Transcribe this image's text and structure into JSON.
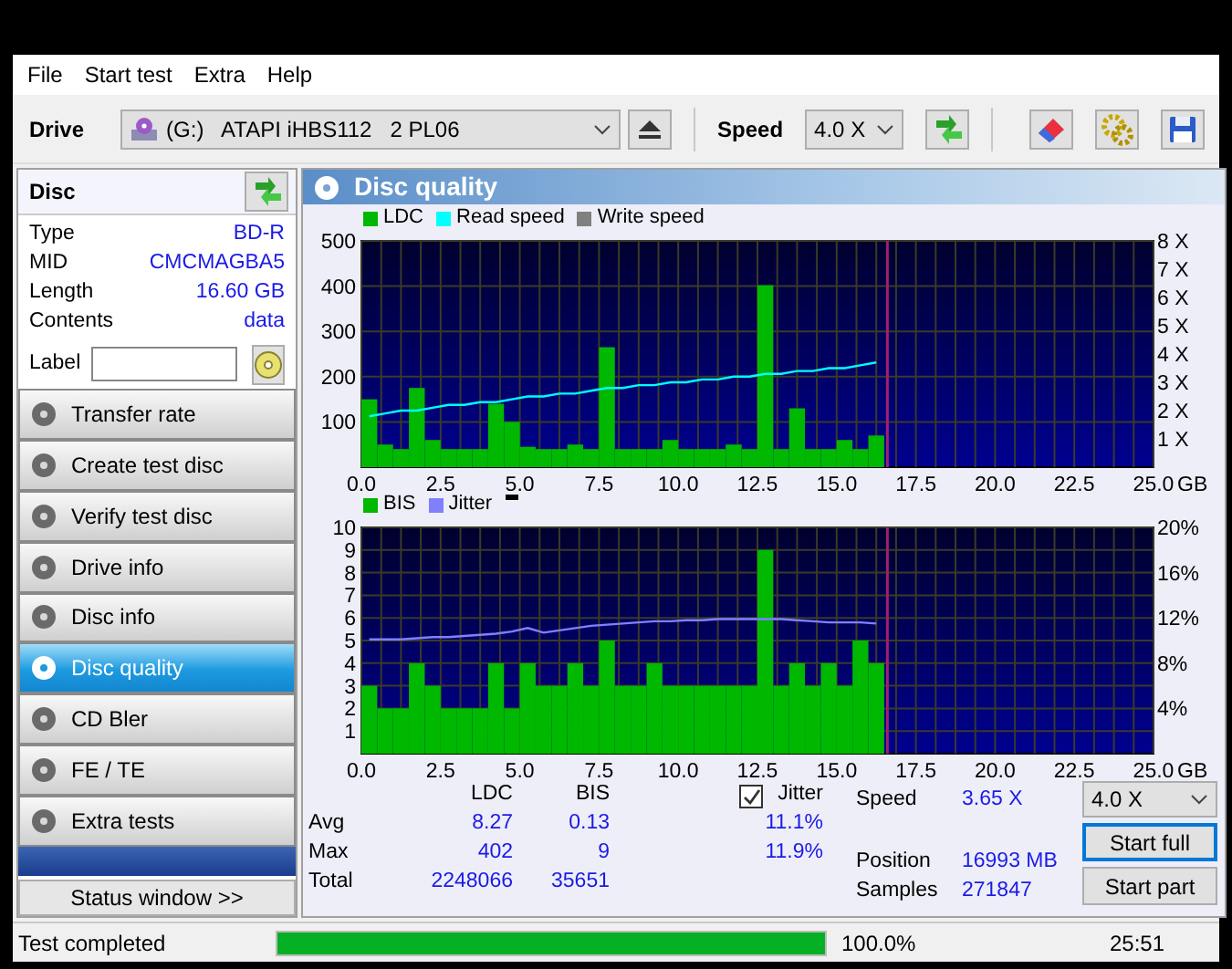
{
  "menu": [
    "File",
    "Start test",
    "Extra",
    "Help"
  ],
  "toolbar": {
    "drive_label": "Drive",
    "drive": "(G:)   ATAPI iHBS112   2 PL06",
    "speed_label": "Speed",
    "speed": "4.0 X"
  },
  "disc": {
    "title": "Disc",
    "fields": [
      {
        "label": "Type",
        "value": "BD-R"
      },
      {
        "label": "MID",
        "value": "CMCMAGBA5"
      },
      {
        "label": "Length",
        "value": "16.60 GB"
      },
      {
        "label": "Contents",
        "value": "data"
      }
    ],
    "label_caption": "Label"
  },
  "nav": [
    {
      "label": "Transfer rate",
      "selected": false
    },
    {
      "label": "Create test disc",
      "selected": false
    },
    {
      "label": "Verify test disc",
      "selected": false
    },
    {
      "label": "Drive info",
      "selected": false
    },
    {
      "label": "Disc info",
      "selected": false
    },
    {
      "label": "Disc quality",
      "selected": true
    },
    {
      "label": "CD Bler",
      "selected": false
    },
    {
      "label": "FE / TE",
      "selected": false
    },
    {
      "label": "Extra tests",
      "selected": false
    }
  ],
  "status_window_button": "Status window >>",
  "panel_title": "Disc quality",
  "charts": [
    {
      "legend_extra": [
        {
          "label": "Write speed",
          "color": "#808080"
        }
      ],
      "chart_data": {
        "type": "bar",
        "xlabel": "GB",
        "xlim": [
          0,
          25
        ],
        "ylim": [
          0,
          500
        ],
        "y2lim": [
          0,
          8
        ],
        "grid": true,
        "xticks": [
          {
            "value": 0,
            "label": "0.0"
          },
          {
            "value": 2.5,
            "label": "2.5"
          },
          {
            "value": 5,
            "label": "5.0"
          },
          {
            "value": 7.5,
            "label": "7.5"
          },
          {
            "value": 10,
            "label": "10.0"
          },
          {
            "value": 12.5,
            "label": "12.5"
          },
          {
            "value": 15,
            "label": "15.0"
          },
          {
            "value": 17.5,
            "label": "17.5"
          },
          {
            "value": 20,
            "label": "20.0"
          },
          {
            "value": 22.5,
            "label": "22.5"
          },
          {
            "value": 25,
            "label": "25.0"
          }
        ],
        "yticks": [
          100,
          200,
          300,
          400,
          500
        ],
        "y2ticks": [
          {
            "value": 1,
            "label": "1 X"
          },
          {
            "value": 2,
            "label": "2 X"
          },
          {
            "value": 3,
            "label": "3 X"
          },
          {
            "value": 4,
            "label": "4 X"
          },
          {
            "value": 5,
            "label": "5 X"
          },
          {
            "value": 6,
            "label": "6 X"
          },
          {
            "value": 7,
            "label": "7 X"
          },
          {
            "value": 8,
            "label": "8 X"
          }
        ],
        "x": [
          0.25,
          0.75,
          1.25,
          1.75,
          2.25,
          2.75,
          3.25,
          3.75,
          4.25,
          4.75,
          5.25,
          5.75,
          6.25,
          6.75,
          7.25,
          7.75,
          8.25,
          8.75,
          9.25,
          9.75,
          10.25,
          10.75,
          11.25,
          11.75,
          12.25,
          12.75,
          13.25,
          13.75,
          14.25,
          14.75,
          15.25,
          15.75,
          16.25
        ],
        "series": [
          {
            "name": "LDC",
            "color": "#00b800",
            "values": [
              150,
              50,
              40,
              175,
              60,
              40,
              40,
              40,
              140,
              100,
              45,
              40,
              40,
              50,
              40,
              265,
              40,
              40,
              40,
              60,
              40,
              40,
              40,
              50,
              40,
              402,
              40,
              130,
              40,
              40,
              60,
              40,
              70
            ]
          },
          {
            "name": "Read speed",
            "color": "#00ffff",
            "type": "line",
            "axis": "y2",
            "values": [
              1.8,
              1.9,
              2.0,
              2.0,
              2.1,
              2.2,
              2.2,
              2.3,
              2.3,
              2.4,
              2.5,
              2.5,
              2.6,
              2.6,
              2.7,
              2.8,
              2.8,
              2.9,
              2.9,
              3.0,
              3.0,
              3.1,
              3.1,
              3.2,
              3.2,
              3.3,
              3.3,
              3.4,
              3.4,
              3.5,
              3.5,
              3.6,
              3.7
            ]
          }
        ],
        "ref_lines": [
          {
            "axis": "x",
            "value": 16.6
          }
        ]
      }
    },
    {
      "chart_data": {
        "type": "bar",
        "xlabel": "GB",
        "xlim": [
          0,
          25
        ],
        "ylim": [
          0,
          10
        ],
        "y2lim": [
          0,
          20
        ],
        "grid": true,
        "xticks": [
          {
            "value": 0,
            "label": "0.0"
          },
          {
            "value": 2.5,
            "label": "2.5"
          },
          {
            "value": 5,
            "label": "5.0"
          },
          {
            "value": 7.5,
            "label": "7.5"
          },
          {
            "value": 10,
            "label": "10.0"
          },
          {
            "value": 12.5,
            "label": "12.5"
          },
          {
            "value": 15,
            "label": "15.0"
          },
          {
            "value": 17.5,
            "label": "17.5"
          },
          {
            "value": 20,
            "label": "20.0"
          },
          {
            "value": 22.5,
            "label": "22.5"
          },
          {
            "value": 25,
            "label": "25.0"
          }
        ],
        "yticks": [
          1,
          2,
          3,
          4,
          5,
          6,
          7,
          8,
          9,
          10
        ],
        "y2ticks": [
          {
            "value": 4,
            "label": "4%"
          },
          {
            "value": 8,
            "label": "8%"
          },
          {
            "value": 12,
            "label": "12%"
          },
          {
            "value": 16,
            "label": "16%"
          },
          {
            "value": 20,
            "label": "20%"
          }
        ],
        "x": [
          0.25,
          0.75,
          1.25,
          1.75,
          2.25,
          2.75,
          3.25,
          3.75,
          4.25,
          4.75,
          5.25,
          5.75,
          6.25,
          6.75,
          7.25,
          7.75,
          8.25,
          8.75,
          9.25,
          9.75,
          10.25,
          10.75,
          11.25,
          11.75,
          12.25,
          12.75,
          13.25,
          13.75,
          14.25,
          14.75,
          15.25,
          15.75,
          16.25
        ],
        "series": [
          {
            "name": "BIS",
            "color": "#00b800",
            "values": [
              3,
              2,
              2,
              4,
              3,
              2,
              2,
              2,
              4,
              2,
              4,
              3,
              3,
              4,
              3,
              5,
              3,
              3,
              4,
              3,
              3,
              3,
              3,
              3,
              3,
              9,
              3,
              4,
              3,
              4,
              3,
              5,
              4
            ]
          },
          {
            "name": "Jitter",
            "color": "#8080ff",
            "type": "line",
            "axis": "y2",
            "values": [
              10.1,
              10.1,
              10.1,
              10.2,
              10.3,
              10.3,
              10.4,
              10.5,
              10.6,
              10.8,
              11.1,
              10.7,
              10.9,
              11.1,
              11.3,
              11.4,
              11.5,
              11.6,
              11.7,
              11.7,
              11.8,
              11.8,
              11.9,
              11.9,
              11.9,
              11.9,
              11.9,
              11.8,
              11.7,
              11.6,
              11.6,
              11.6,
              11.5
            ]
          }
        ],
        "ref_lines": [
          {
            "axis": "x",
            "value": 16.6
          }
        ]
      }
    }
  ],
  "stats": {
    "columns": [
      "LDC",
      "BIS"
    ],
    "jitter": {
      "label": "Jitter",
      "checked": true
    },
    "rows": [
      {
        "label": "Avg",
        "ldc": "8.27",
        "bis": "0.13",
        "jitter": "11.1%"
      },
      {
        "label": "Max",
        "ldc": "402",
        "bis": "9",
        "jitter": "11.9%"
      },
      {
        "label": "Total",
        "ldc": "2248066",
        "bis": "35651"
      }
    ]
  },
  "readings": [
    {
      "label": "Speed",
      "value": "3.65 X"
    },
    {
      "label": "Position",
      "value": "16993 MB"
    },
    {
      "label": "Samples",
      "value": "271847"
    }
  ],
  "speed_select": "4.0 X",
  "buttons": [
    {
      "label": "Start full",
      "focused": true
    },
    {
      "label": "Start part",
      "focused": false
    }
  ],
  "status_bar": {
    "message": "Test completed",
    "level": 1.0,
    "percent": "100.0%",
    "time": "25:51"
  }
}
